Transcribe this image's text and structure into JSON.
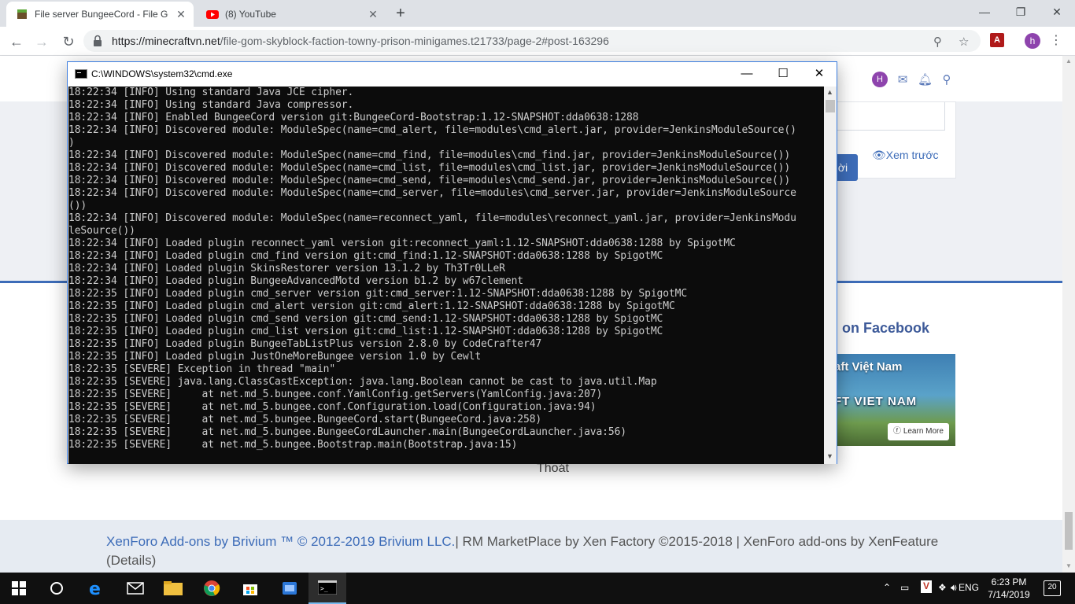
{
  "browser": {
    "tabs": [
      {
        "title": "File server BungeeCord - File Gộp",
        "icon": "minecraft-block-icon",
        "active": true
      },
      {
        "title": "(8) YouTube",
        "icon": "youtube-icon",
        "active": false
      }
    ],
    "new_tab_glyph": "+",
    "window_controls": {
      "minimize": "—",
      "maximize": "❐",
      "close": "✕"
    },
    "nav": {
      "back": "←",
      "forward": "→",
      "reload": "↻"
    },
    "url_host": "https://minecraftvn.net",
    "url_path": "/file-gom-skyblock-faction-towny-prison-minigames.t21733/page-2#post-163296",
    "pdf_ext_label": "A",
    "profile_initial": "h",
    "menu_glyph": "⋮"
  },
  "page": {
    "header_avatar": "H",
    "reply_button": "ời",
    "preview_link": "Xem trước",
    "facebook_title": "on Facebook",
    "facebook_page_name": "aft Việt Nam",
    "facebook_logo_text": "FT VIET NAM",
    "facebook_button": "Learn More",
    "logout": "Thoát",
    "footer": {
      "brand": "XenForo Add-ons by Brivium ™ © 2012-2019 Brivium LLC.",
      "rest": "| RM MarketPlace by Xen Factory ©2015-2018 | XenForo add-ons by XenFeature (Details)"
    }
  },
  "cmd": {
    "title": "C:\\WINDOWS\\system32\\cmd.exe",
    "lines": [
      "18:22:34 [INFO] Using standard Java JCE cipher.",
      "18:22:34 [INFO] Using standard Java compressor.",
      "18:22:34 [INFO] Enabled BungeeCord version git:BungeeCord-Bootstrap:1.12-SNAPSHOT:dda0638:1288",
      "18:22:34 [INFO] Discovered module: ModuleSpec(name=cmd_alert, file=modules\\cmd_alert.jar, provider=JenkinsModuleSource()",
      ")",
      "18:22:34 [INFO] Discovered module: ModuleSpec(name=cmd_find, file=modules\\cmd_find.jar, provider=JenkinsModuleSource())",
      "18:22:34 [INFO] Discovered module: ModuleSpec(name=cmd_list, file=modules\\cmd_list.jar, provider=JenkinsModuleSource())",
      "18:22:34 [INFO] Discovered module: ModuleSpec(name=cmd_send, file=modules\\cmd_send.jar, provider=JenkinsModuleSource())",
      "18:22:34 [INFO] Discovered module: ModuleSpec(name=cmd_server, file=modules\\cmd_server.jar, provider=JenkinsModuleSource",
      "())",
      "18:22:34 [INFO] Discovered module: ModuleSpec(name=reconnect_yaml, file=modules\\reconnect_yaml.jar, provider=JenkinsModu",
      "leSource())",
      "18:22:34 [INFO] Loaded plugin reconnect_yaml version git:reconnect_yaml:1.12-SNAPSHOT:dda0638:1288 by SpigotMC",
      "18:22:34 [INFO] Loaded plugin cmd_find version git:cmd_find:1.12-SNAPSHOT:dda0638:1288 by SpigotMC",
      "18:22:34 [INFO] Loaded plugin SkinsRestorer version 13.1.2 by Th3Tr0LLeR",
      "18:22:34 [INFO] Loaded plugin BungeeAdvancedMotd version b1.2 by w67clement",
      "18:22:35 [INFO] Loaded plugin cmd_server version git:cmd_server:1.12-SNAPSHOT:dda0638:1288 by SpigotMC",
      "18:22:35 [INFO] Loaded plugin cmd_alert version git:cmd_alert:1.12-SNAPSHOT:dda0638:1288 by SpigotMC",
      "18:22:35 [INFO] Loaded plugin cmd_send version git:cmd_send:1.12-SNAPSHOT:dda0638:1288 by SpigotMC",
      "18:22:35 [INFO] Loaded plugin cmd_list version git:cmd_list:1.12-SNAPSHOT:dda0638:1288 by SpigotMC",
      "18:22:35 [INFO] Loaded plugin BungeeTabListPlus version 2.8.0 by CodeCrafter47",
      "18:22:35 [INFO] Loaded plugin JustOneMoreBungee version 1.0 by Cewlt",
      "18:22:35 [SEVERE] Exception in thread \"main\"",
      "18:22:35 [SEVERE] java.lang.ClassCastException: java.lang.Boolean cannot be cast to java.util.Map",
      "18:22:35 [SEVERE]     at net.md_5.bungee.conf.YamlConfig.getServers(YamlConfig.java:207)",
      "18:22:35 [SEVERE]     at net.md_5.bungee.conf.Configuration.load(Configuration.java:94)",
      "18:22:35 [SEVERE]     at net.md_5.bungee.BungeeCord.start(BungeeCord.java:258)",
      "18:22:35 [SEVERE]     at net.md_5.bungee.BungeeCordLauncher.main(BungeeCordLauncher.java:56)",
      "18:22:35 [SEVERE]     at net.md_5.bungee.Bootstrap.main(Bootstrap.java:15)"
    ]
  },
  "taskbar": {
    "items": [
      "windows-start-icon",
      "cortana-icon",
      "edge-icon",
      "mail-icon",
      "file-explorer-icon",
      "chrome-icon",
      "store-icon",
      "blue-app-icon",
      "cmd-icon"
    ],
    "language": "ENG",
    "time": "6:23 PM",
    "date": "7/14/2019",
    "notifications": "20"
  }
}
